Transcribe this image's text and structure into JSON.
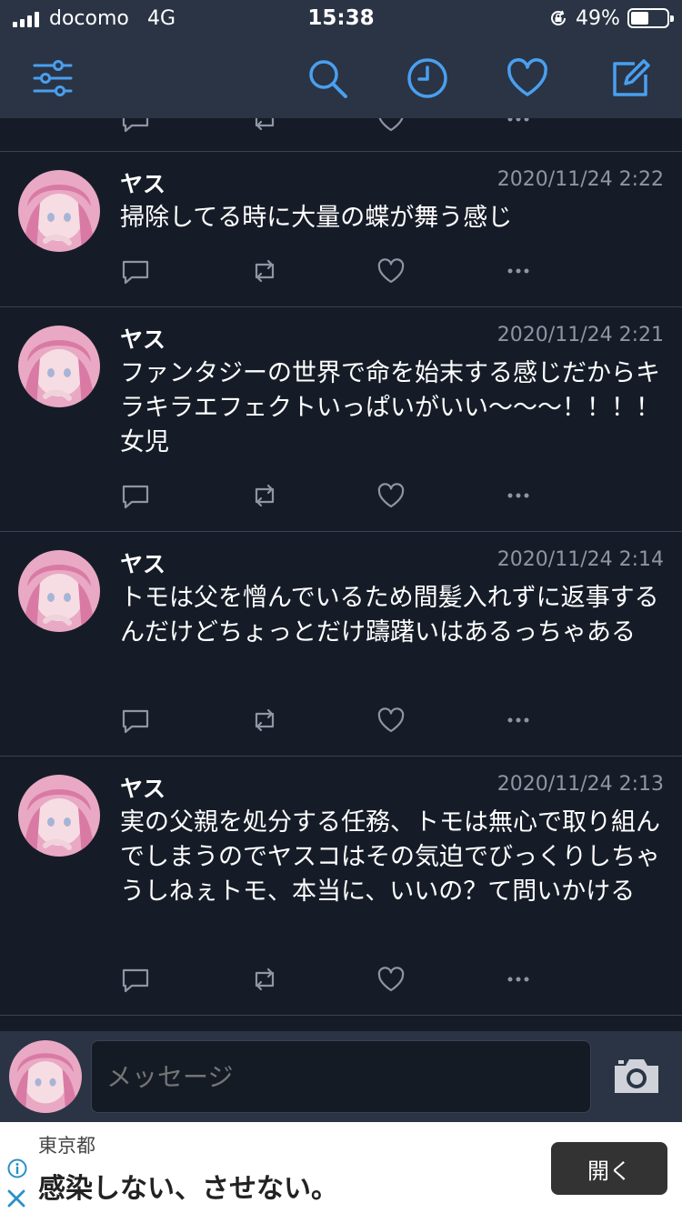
{
  "status_bar": {
    "carrier": "docomo",
    "network": "4G",
    "time": "15:38",
    "battery_percent_text": "49%",
    "battery_level": 0.49
  },
  "nav": {
    "icons": [
      "filter-settings-icon",
      "search-icon",
      "history-clock-icon",
      "heart-icon",
      "compose-icon"
    ],
    "accent_color": "#4a9ff0"
  },
  "tweets": [
    {
      "name": "ヤス",
      "time": "2020/11/24 2:22",
      "text": "掃除してる時に大量の蝶が舞う感じ"
    },
    {
      "name": "ヤス",
      "time": "2020/11/24 2:21",
      "text": "ファンタジーの世界で命を始末する感じだからキラキラエフェクトいっぱいがいい〜〜〜！！！！女児"
    },
    {
      "name": "ヤス",
      "time": "2020/11/24 2:14",
      "text": "トモは父を憎んでいるため間髪入れずに返事するんだけどちょっとだけ躊躇いはあるっちゃある"
    },
    {
      "name": "ヤス",
      "time": "2020/11/24 2:13",
      "text": "実の父親を処分する任務、トモは無心で取り組んでしまうのでヤスコはその気迫でびっくりしちゃうしねぇトモ、本当に、いいの？て問いかける"
    }
  ],
  "compose": {
    "placeholder": "メッセージ"
  },
  "ad": {
    "sponsor": "東京都",
    "headline": "感染しない、させない。",
    "button_label": "開く"
  }
}
